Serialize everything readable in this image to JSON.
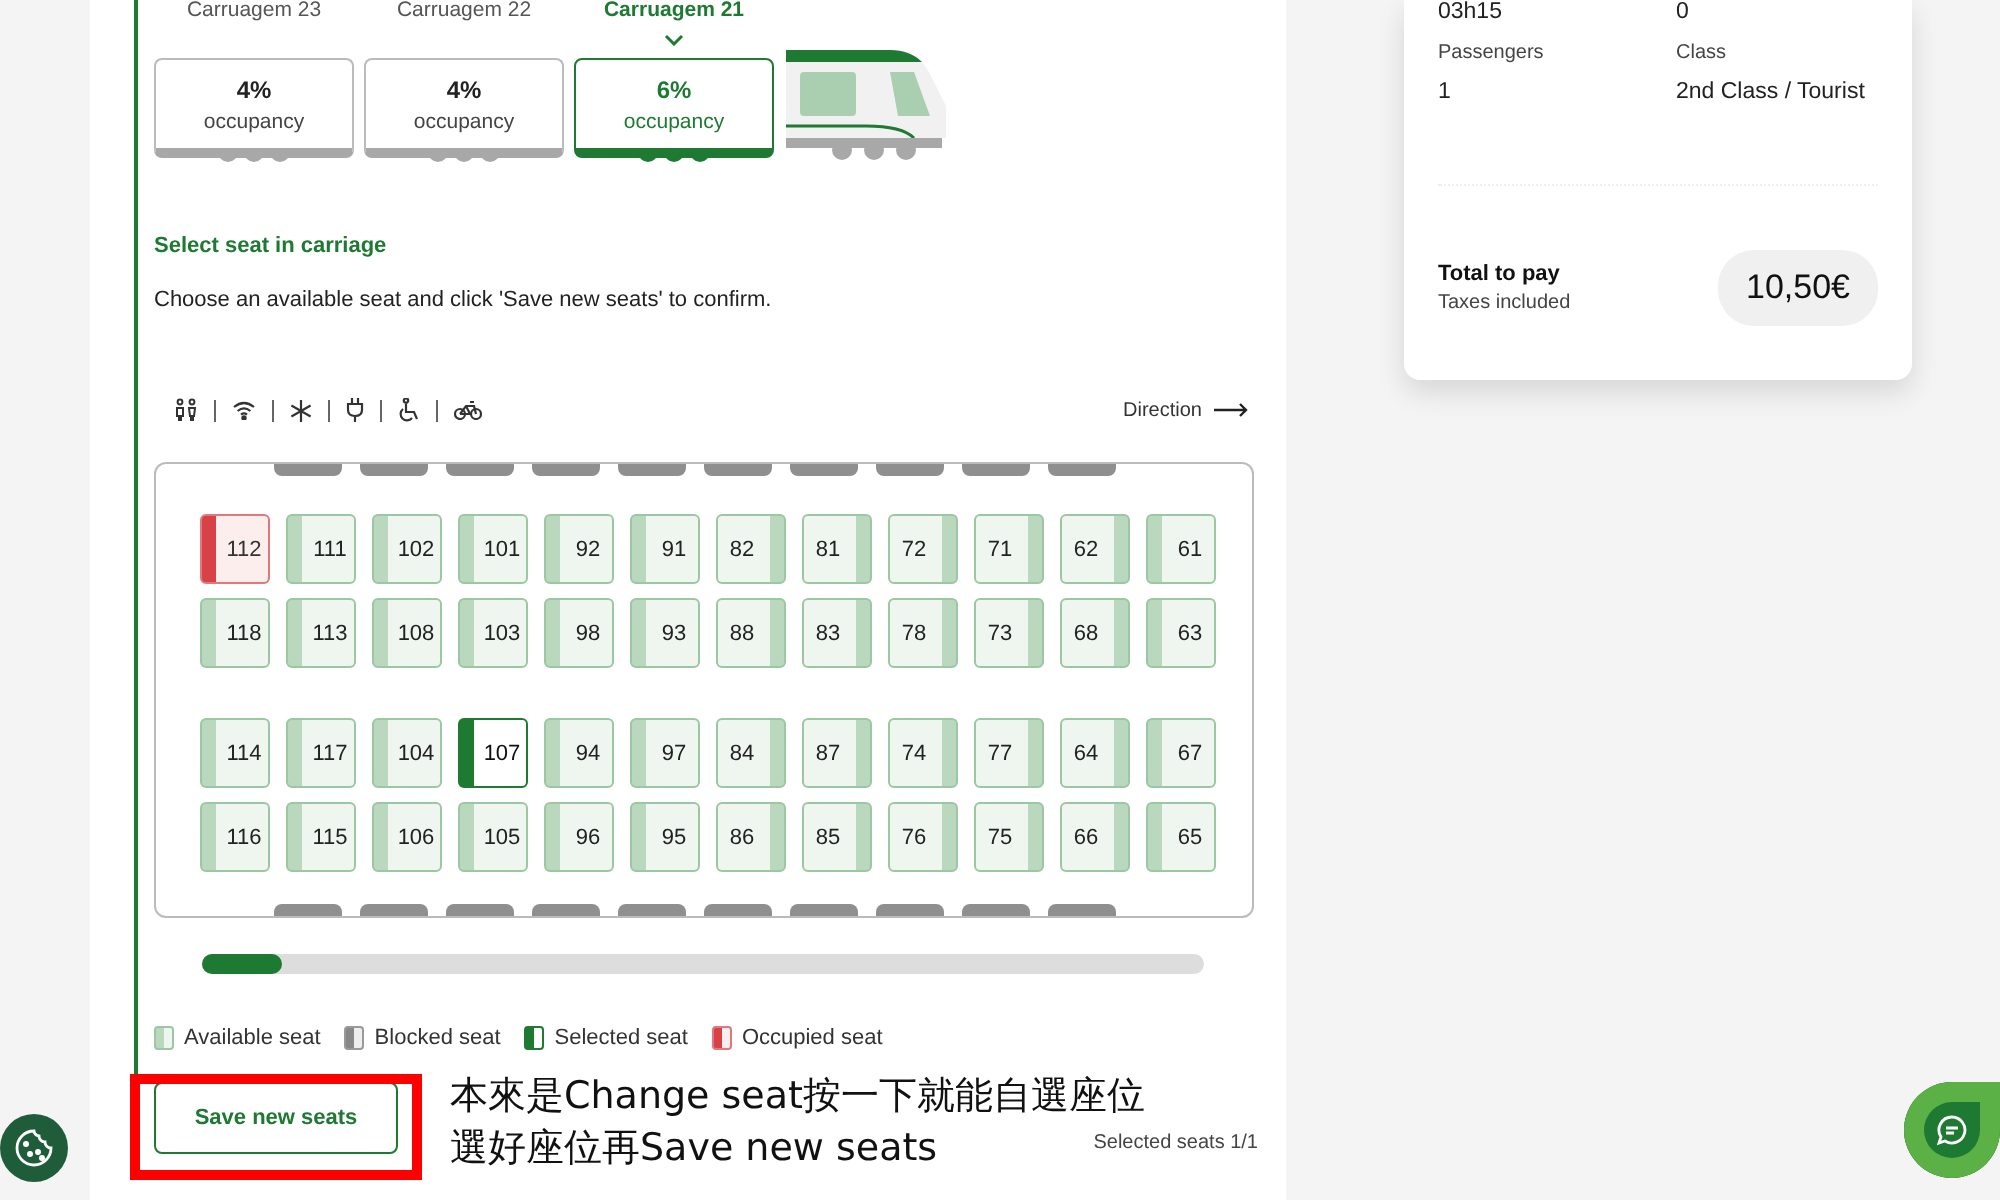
{
  "carriages": [
    {
      "label": "Carruagem 23",
      "occupancy": "4%",
      "caption": "occupancy",
      "selected": false
    },
    {
      "label": "Carruagem 22",
      "occupancy": "4%",
      "caption": "occupancy",
      "selected": false
    },
    {
      "label": "Carruagem 21",
      "occupancy": "6%",
      "caption": "occupancy",
      "selected": true
    }
  ],
  "section_title": "Select seat in carriage",
  "instruction": "Choose an available seat and click 'Save new seats' to confirm.",
  "amenities": [
    {
      "kind": "toilet"
    },
    {
      "kind": "wifi"
    },
    {
      "kind": "ac"
    },
    {
      "kind": "plug"
    },
    {
      "kind": "wheelchair"
    },
    {
      "kind": "bicycle"
    }
  ],
  "direction": {
    "label": "Direction"
  },
  "seat_rows": [
    [
      {
        "number": "112",
        "kind": "occupied",
        "back_right": false
      },
      {
        "number": "111",
        "kind": "available",
        "back_right": false
      },
      {
        "number": "102",
        "kind": "available",
        "back_right": false
      },
      {
        "number": "101",
        "kind": "available",
        "back_right": false
      },
      {
        "number": "92",
        "kind": "available",
        "back_right": false
      },
      {
        "number": "91",
        "kind": "available",
        "back_right": false
      },
      {
        "number": "82",
        "kind": "available",
        "back_right": true
      },
      {
        "number": "81",
        "kind": "available",
        "back_right": true
      },
      {
        "number": "72",
        "kind": "available",
        "back_right": true
      },
      {
        "number": "71",
        "kind": "available",
        "back_right": true
      },
      {
        "number": "62",
        "kind": "available",
        "back_right": true
      },
      {
        "number": "61",
        "kind": "available",
        "back_right": false
      }
    ],
    [
      {
        "number": "118",
        "kind": "available",
        "back_right": false
      },
      {
        "number": "113",
        "kind": "available",
        "back_right": false
      },
      {
        "number": "108",
        "kind": "available",
        "back_right": false
      },
      {
        "number": "103",
        "kind": "available",
        "back_right": false
      },
      {
        "number": "98",
        "kind": "available",
        "back_right": false
      },
      {
        "number": "93",
        "kind": "available",
        "back_right": false
      },
      {
        "number": "88",
        "kind": "available",
        "back_right": true
      },
      {
        "number": "83",
        "kind": "available",
        "back_right": true
      },
      {
        "number": "78",
        "kind": "available",
        "back_right": true
      },
      {
        "number": "73",
        "kind": "available",
        "back_right": true
      },
      {
        "number": "68",
        "kind": "available",
        "back_right": true
      },
      {
        "number": "63",
        "kind": "available",
        "back_right": false
      }
    ],
    [
      {
        "number": "114",
        "kind": "available",
        "back_right": false
      },
      {
        "number": "117",
        "kind": "available",
        "back_right": false
      },
      {
        "number": "104",
        "kind": "available",
        "back_right": false
      },
      {
        "number": "107",
        "kind": "selected",
        "back_right": false
      },
      {
        "number": "94",
        "kind": "available",
        "back_right": false
      },
      {
        "number": "97",
        "kind": "available",
        "back_right": false
      },
      {
        "number": "84",
        "kind": "available",
        "back_right": true
      },
      {
        "number": "87",
        "kind": "available",
        "back_right": true
      },
      {
        "number": "74",
        "kind": "available",
        "back_right": true
      },
      {
        "number": "77",
        "kind": "available",
        "back_right": true
      },
      {
        "number": "64",
        "kind": "available",
        "back_right": true
      },
      {
        "number": "67",
        "kind": "available",
        "back_right": false
      }
    ],
    [
      {
        "number": "116",
        "kind": "available",
        "back_right": false
      },
      {
        "number": "115",
        "kind": "available",
        "back_right": false
      },
      {
        "number": "106",
        "kind": "available",
        "back_right": false
      },
      {
        "number": "105",
        "kind": "available",
        "back_right": false
      },
      {
        "number": "96",
        "kind": "available",
        "back_right": false
      },
      {
        "number": "95",
        "kind": "available",
        "back_right": false
      },
      {
        "number": "86",
        "kind": "available",
        "back_right": true
      },
      {
        "number": "85",
        "kind": "available",
        "back_right": true
      },
      {
        "number": "76",
        "kind": "available",
        "back_right": true
      },
      {
        "number": "75",
        "kind": "available",
        "back_right": true
      },
      {
        "number": "66",
        "kind": "available",
        "back_right": true
      },
      {
        "number": "65",
        "kind": "available",
        "back_right": false
      }
    ]
  ],
  "legend": [
    {
      "kind": "available",
      "label": "Available seat"
    },
    {
      "kind": "blocked",
      "label": "Blocked seat"
    },
    {
      "kind": "selected",
      "label": "Selected seat"
    },
    {
      "kind": "occupied",
      "label": "Occupied seat"
    }
  ],
  "save_button": "Save new seats",
  "selected_count": "Selected seats 1/1",
  "summary": {
    "duration": "03h15",
    "transfers": "0",
    "fields": [
      {
        "label": "Passengers",
        "value": "1"
      },
      {
        "label": "Class",
        "value": "2nd Class / Tourist"
      }
    ],
    "total_label": "Total to pay",
    "total_note": "Taxes included",
    "total": "10,50€"
  },
  "annotation": {
    "lines": [
      "本來是Change seat按一下就能自選座位",
      "選好座位再Save new seats"
    ]
  }
}
